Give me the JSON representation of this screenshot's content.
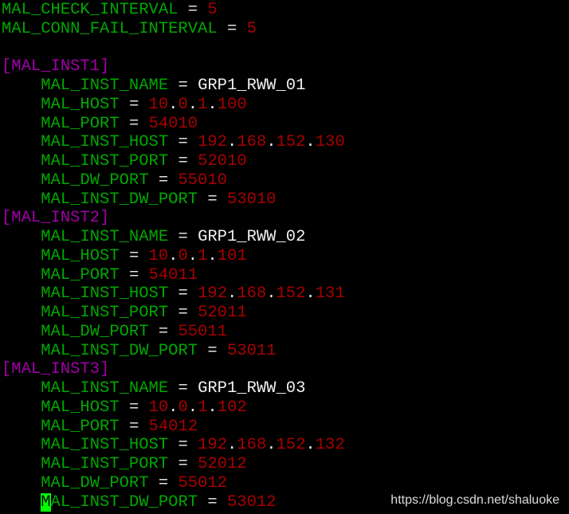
{
  "terminal": {
    "colors": {
      "key": "#00a800",
      "value_number": "#a80000",
      "value_text": "#f0f0f0",
      "section": "#a000a8",
      "cursor": "#00ff00",
      "background": "#000000"
    },
    "lines": [
      {
        "type": "kv",
        "indent": 0,
        "key": "MAL_CHECK_INTERVAL",
        "value": "5"
      },
      {
        "type": "kv",
        "indent": 0,
        "key": "MAL_CONN_FAIL_INTERVAL",
        "value": "5"
      },
      {
        "type": "blank"
      },
      {
        "type": "section",
        "text": "[MAL_INST1]"
      },
      {
        "type": "kv",
        "indent": 4,
        "key": "MAL_INST_NAME",
        "value": "GRP1_RWW_01"
      },
      {
        "type": "kv",
        "indent": 4,
        "key": "MAL_HOST",
        "value": "10.0.1.100"
      },
      {
        "type": "kv",
        "indent": 4,
        "key": "MAL_PORT",
        "value": "54010"
      },
      {
        "type": "kv",
        "indent": 4,
        "key": "MAL_INST_HOST",
        "value": "192.168.152.130"
      },
      {
        "type": "kv",
        "indent": 4,
        "key": "MAL_INST_PORT",
        "value": "52010"
      },
      {
        "type": "kv",
        "indent": 4,
        "key": "MAL_DW_PORT",
        "value": "55010"
      },
      {
        "type": "kv",
        "indent": 4,
        "key": "MAL_INST_DW_PORT",
        "value": "53010"
      },
      {
        "type": "section",
        "text": "[MAL_INST2]"
      },
      {
        "type": "kv",
        "indent": 4,
        "key": "MAL_INST_NAME",
        "value": "GRP1_RWW_02"
      },
      {
        "type": "kv",
        "indent": 4,
        "key": "MAL_HOST",
        "value": "10.0.1.101"
      },
      {
        "type": "kv",
        "indent": 4,
        "key": "MAL_PORT",
        "value": "54011"
      },
      {
        "type": "kv",
        "indent": 4,
        "key": "MAL_INST_HOST",
        "value": "192.168.152.131"
      },
      {
        "type": "kv",
        "indent": 4,
        "key": "MAL_INST_PORT",
        "value": "52011"
      },
      {
        "type": "kv",
        "indent": 4,
        "key": "MAL_DW_PORT",
        "value": "55011"
      },
      {
        "type": "kv",
        "indent": 4,
        "key": "MAL_INST_DW_PORT",
        "value": "53011"
      },
      {
        "type": "section",
        "text": "[MAL_INST3]"
      },
      {
        "type": "kv",
        "indent": 4,
        "key": "MAL_INST_NAME",
        "value": "GRP1_RWW_03"
      },
      {
        "type": "kv",
        "indent": 4,
        "key": "MAL_HOST",
        "value": "10.0.1.102"
      },
      {
        "type": "kv",
        "indent": 4,
        "key": "MAL_PORT",
        "value": "54012"
      },
      {
        "type": "kv",
        "indent": 4,
        "key": "MAL_INST_HOST",
        "value": "192.168.152.132"
      },
      {
        "type": "kv",
        "indent": 4,
        "key": "MAL_INST_PORT",
        "value": "52012"
      },
      {
        "type": "kv",
        "indent": 4,
        "key": "MAL_DW_PORT",
        "value": "55012"
      },
      {
        "type": "kv",
        "indent": 4,
        "key": "MAL_INST_DW_PORT",
        "value": "53012",
        "cursor": true
      }
    ]
  },
  "watermark": "https://blog.csdn.net/shaluoke"
}
